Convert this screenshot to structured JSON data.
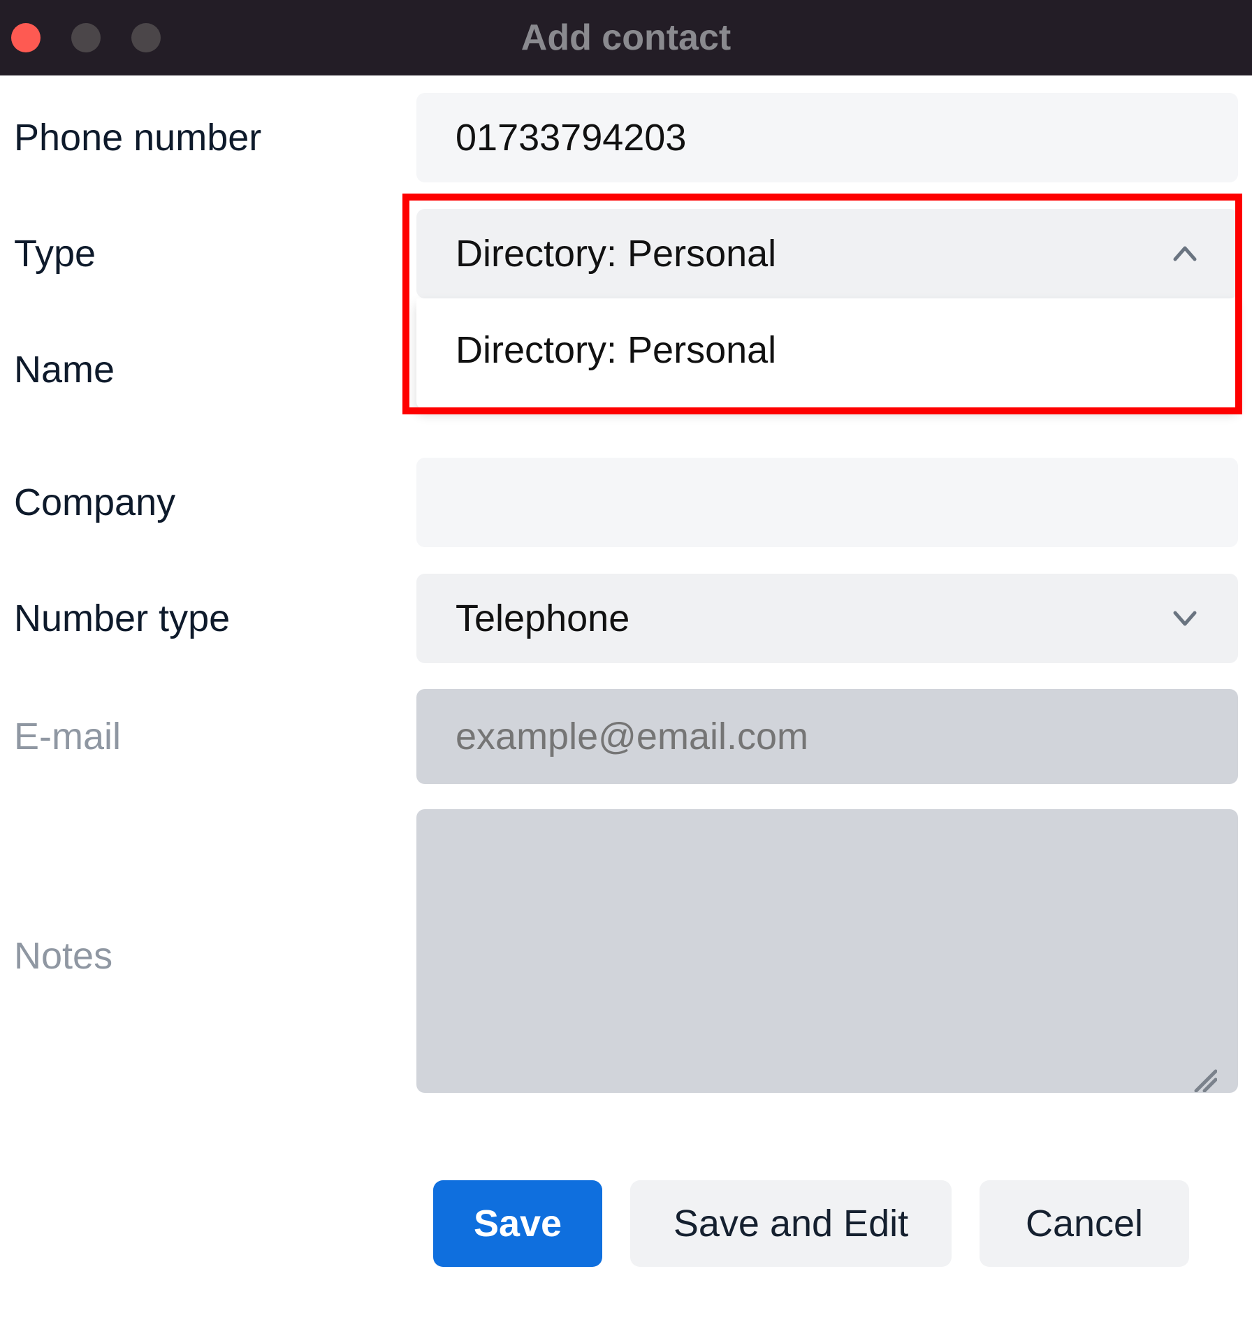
{
  "window": {
    "title": "Add contact"
  },
  "fields": {
    "phone_number": {
      "label": "Phone number",
      "value": "01733794203"
    },
    "type": {
      "label": "Type",
      "selected": "Directory: Personal",
      "options": [
        "Directory: Personal"
      ]
    },
    "name": {
      "label": "Name",
      "value": ""
    },
    "company": {
      "label": "Company",
      "value": ""
    },
    "number_type": {
      "label": "Number type",
      "selected": "Telephone"
    },
    "email": {
      "label": "E-mail",
      "value": "",
      "placeholder": "example@email.com"
    },
    "notes": {
      "label": "Notes",
      "value": ""
    }
  },
  "buttons": {
    "save": "Save",
    "save_and_edit": "Save and Edit",
    "cancel": "Cancel"
  },
  "colors": {
    "title_bar_bg": "#231d26",
    "primary_button": "#0f6fde",
    "field_bg_light": "#f5f6f8",
    "field_bg_dark": "#d1d4da",
    "highlight": "#fe0000",
    "traffic_close": "#fe5a52"
  }
}
